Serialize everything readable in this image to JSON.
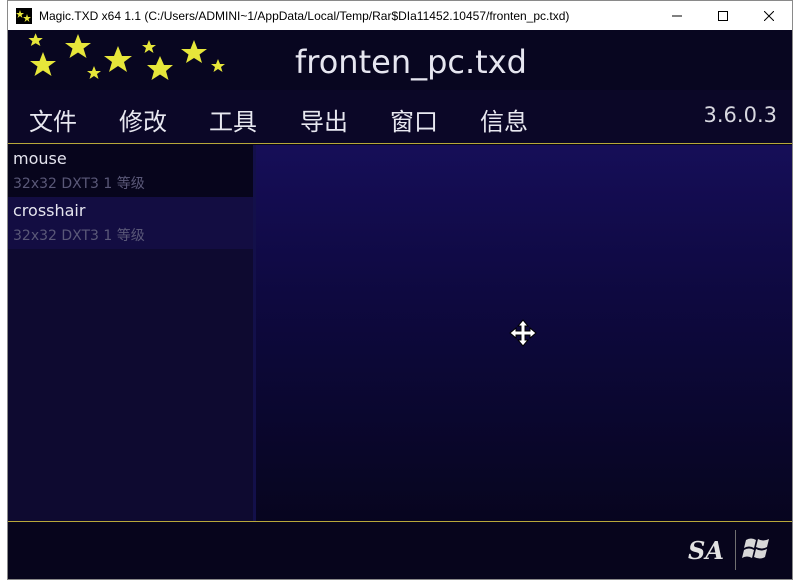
{
  "window": {
    "title": "Magic.TXD x64 1.1 (C:/Users/ADMINI~1/AppData/Local/Temp/Rar$DIa11452.10457/fronten_pc.txd)",
    "controls": {
      "minimize_icon": "minimize-icon",
      "maximize_icon": "maximize-icon",
      "close_icon": "close-icon"
    }
  },
  "header": {
    "file_name": "fronten_pc.txd",
    "decoration": "stars-logo"
  },
  "menu": {
    "items": [
      "文件",
      "修改",
      "工具",
      "导出",
      "窗口",
      "信息"
    ],
    "version": "3.6.0.3"
  },
  "textures": [
    {
      "name": "mouse",
      "info": "32x32 DXT3 1 等级"
    },
    {
      "name": "crosshair",
      "info": "32x32 DXT3 1 等级"
    }
  ],
  "preview": {
    "cursor_icon": "move-cursor-icon"
  },
  "footer": {
    "game_logo": "SA",
    "platform_icon": "windows-logo-icon"
  },
  "colors": {
    "background": "#07051c",
    "accent_line": "#b8a83a",
    "selected_item": "#0f0b3a",
    "star_yellow": "#e6e63a"
  }
}
